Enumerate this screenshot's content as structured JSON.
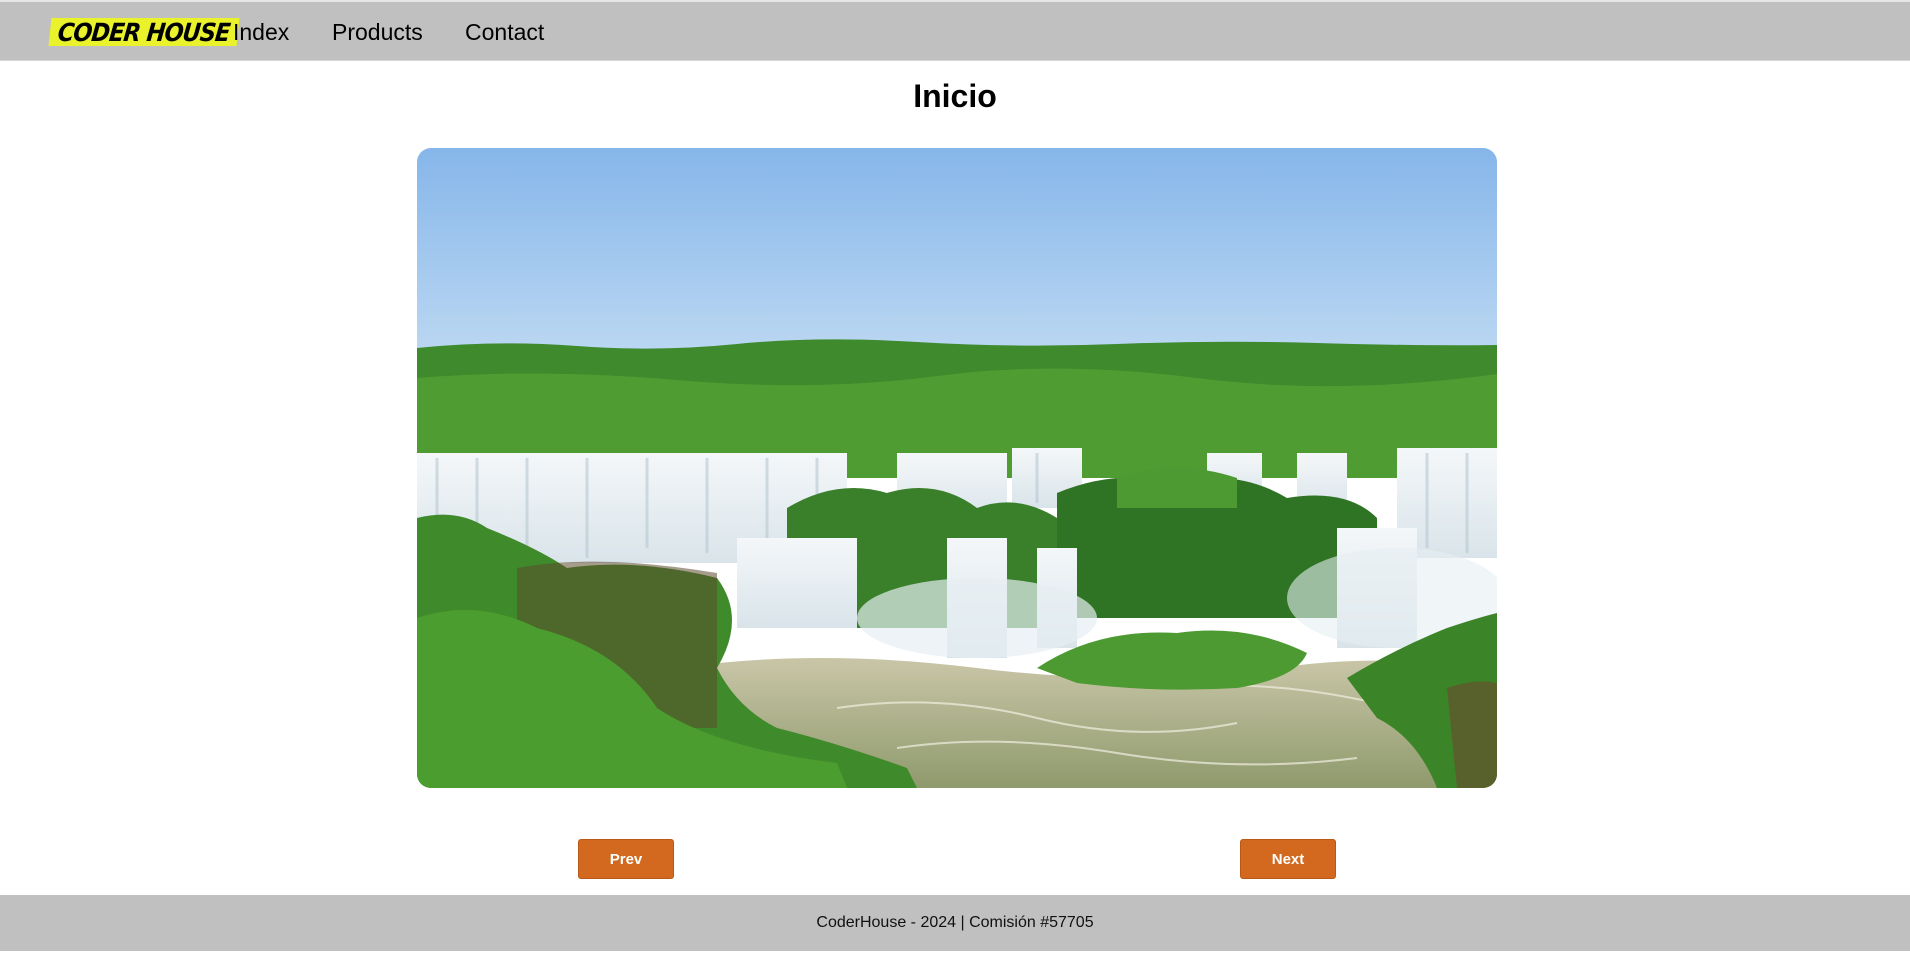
{
  "header": {
    "logo_text": "CODER HOUSE",
    "nav": [
      {
        "label": "Index"
      },
      {
        "label": "Products"
      },
      {
        "label": "Contact"
      }
    ]
  },
  "main": {
    "title": "Inicio",
    "hero_image_alt": "waterfall-landscape",
    "prev_label": "Prev",
    "next_label": "Next"
  },
  "footer": {
    "text": "CoderHouse - 2024 | Comisión #57705"
  },
  "colors": {
    "header_bg": "#c0c0c0",
    "logo_bg": "#e9f22a",
    "button_bg": "#d2691e",
    "footer_bg": "#c0c0c0"
  }
}
